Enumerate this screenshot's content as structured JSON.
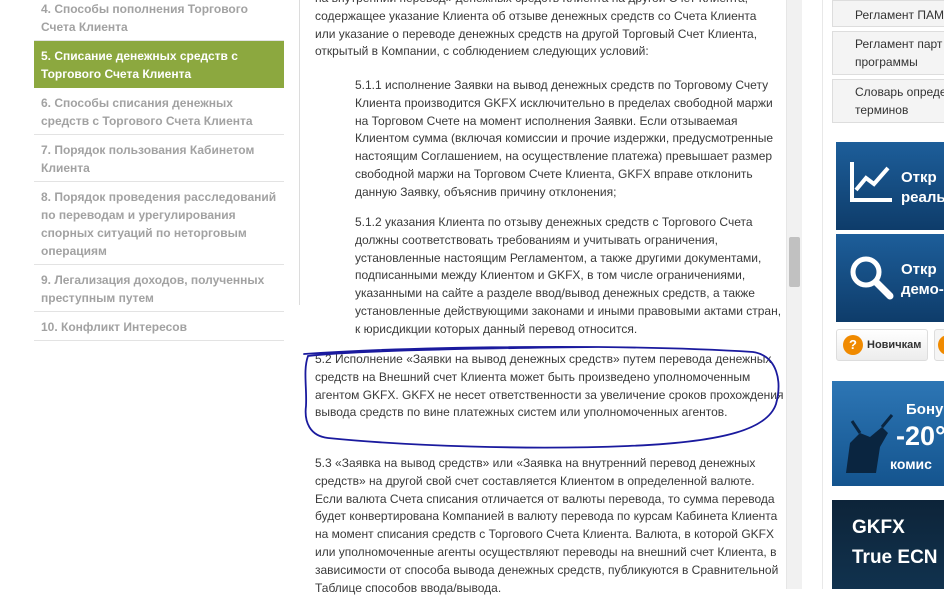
{
  "left_nav": {
    "items": [
      {
        "label": "4. Способы пополнения Торгового Счета Клиента",
        "active": false
      },
      {
        "label": "5. Списание денежных средств с Торгового Счета Клиента",
        "active": true
      },
      {
        "label": "6. Способы списания денежных средств с Торгового Счета Клиента",
        "active": false
      },
      {
        "label": "7. Порядок пользования Кабинетом Клиента",
        "active": false
      },
      {
        "label": "8. Порядок проведения расследований по переводам и урегулирования спорных ситуаций по неторговым операциям",
        "active": false
      },
      {
        "label": "9. Легализация доходов, полученных преступным путем",
        "active": false
      },
      {
        "label": "10. Конфликт Интересов",
        "active": false
      }
    ]
  },
  "article": {
    "para_top": "на внутренний перевод» денежных средств Клиента на другой Счет Клиента, содержащее указание Клиента об отзыве денежных средств со Счета Клиента или указание о переводе денежных средств на другой Торговый Счет Клиента, открытый в Компании, с соблюдением следующих условий:",
    "para_511": "5.1.1 исполнение Заявки на вывод денежных средств по Торговому Счету Клиента производится GKFX исключительно в пределах свободной маржи на Торговом Счете на момент исполнения Заявки. Если отзываемая Клиентом сумма (включая комиссии и прочие издержки, предусмотренные настоящим Соглашением, на осуществление платежа) превышает размер свободной маржи на Торговом Счете Клиента, GKFX вправе отклонить данную Заявку, объяснив причину отклонения;",
    "para_512": "5.1.2 указания Клиента по отзыву денежных средств с Торгового Счета должны соответствовать требованиям и учитывать ограничения, установленные настоящим Регламентом, а также другими документами, подписанными между Клиентом и GKFX, в том числе ограничениями, указанными на сайте а разделе ввод/вывод денежных средств, а также установленные действующими законами и иными правовыми актами стран, к юрисдикции которых данный перевод относится.",
    "para_52": "5.2 Исполнение «Заявки на вывод денежных средств» путем перевода денежных средств на Внешний счет Клиента  может быть произведено уполномоченным агентом GKFX. GKFX не несет ответственности за увеличение сроков прохождения вывода средств по вине платежных систем или уполномоченных агентов.",
    "para_53": "5.3 «Заявка на вывод средств» или «Заявка на внутренний перевод денежных средств» на другой свой счет составляется Клиентом в определенной валюте. Если валюта Счета списания отличается от валюты перевода, то сумма перевода будет конвертирована Компанией в валюту перевода по курсам Кабинета Клиента на момент списания средств с Торгового Счета Клиента. Валюта, в которой GKFX или уполномоченные агенты осуществляют переводы на внешний счет Клиента, в зависимости от способа вывода денежных средств, публикуются в Сравнительной Таблице способов ввода/вывода."
  },
  "annotation": {
    "color": "#1a1a9e"
  },
  "sidebar": {
    "doc_links": [
      {
        "label_lines": [
          "Регламент ПАМ"
        ]
      },
      {
        "label_lines": [
          "Регламент парт",
          "программы"
        ]
      },
      {
        "label_lines": [
          "Словарь опреде",
          "терминов"
        ]
      }
    ],
    "banner_real": {
      "line1": "Откр",
      "line2": "реаль",
      "icon": "chart-icon"
    },
    "banner_demo": {
      "line1": "Откр",
      "line2": "демо-",
      "icon": "magnifier-icon"
    },
    "newbie_button": {
      "label": "Новичкам",
      "icon": "question-icon"
    },
    "bonus_banner": {
      "line1": "Бону",
      "line2": "-20°",
      "line3": "комис"
    },
    "ecn_banner": {
      "line1": "GKFX",
      "line2": "True ECN"
    }
  },
  "colors": {
    "nav_active_bg": "#8ca83f",
    "nav_text": "#a2a2a2",
    "body_text": "#3a3a3a",
    "annotation": "#1a1a9e",
    "banner_blue": "#1d5e9a",
    "accent_orange": "#f08a00"
  }
}
